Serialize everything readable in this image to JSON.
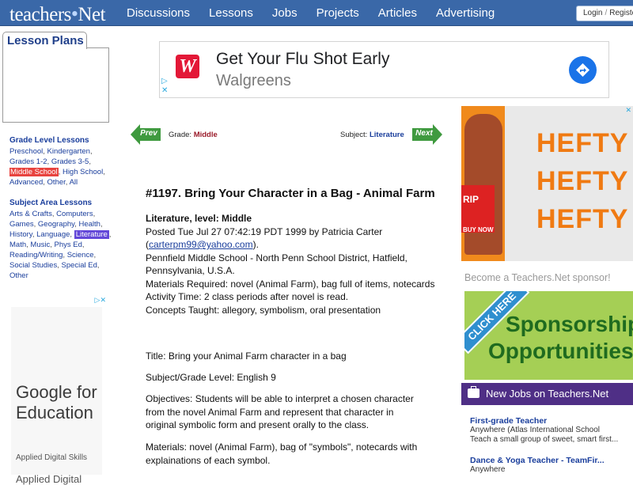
{
  "header": {
    "logo": "teachers",
    "logo_tld": "net",
    "nav": [
      "Discussions",
      "Lessons",
      "Jobs",
      "Projects",
      "Articles",
      "Advertising"
    ],
    "login": "Login",
    "register": "Registe"
  },
  "sidebar": {
    "tab_title": "Lesson Plans",
    "grade_heading": "Grade Level Lessons",
    "grade_links": [
      "Preschool",
      "Kindergarten",
      "Grades 1-2",
      "Grades 3-5",
      "Middle School",
      "High School",
      "Advanced",
      "Other",
      "All"
    ],
    "subject_heading": "Subject Area Lessons",
    "subject_links": [
      "Arts & Crafts",
      "Computers",
      "Games",
      "Geography",
      "Health",
      "History",
      "Language",
      "Literature",
      "Math",
      "Music",
      "Phys Ed",
      "Reading/Writing",
      "Science",
      "Social Studies",
      "Special Ed",
      "Other"
    ],
    "ad_title": "Google for Education",
    "ad_sub": "Applied Digital Skills",
    "ad_sub2": "Applied Digital"
  },
  "banner_ad": {
    "headline": "Get Your Flu Shot Early",
    "brand": "Walgreens",
    "logo_letter": "W"
  },
  "lesson_nav": {
    "prev": "Prev",
    "next": "Next",
    "grade_label": "Grade:",
    "grade_value": "Middle",
    "subject_label": "Subject:",
    "subject_value": "Literature"
  },
  "lesson": {
    "title": "#1197. Bring Your Character in a Bag - Animal Farm",
    "level_line": "Literature, level: Middle",
    "posted": "Posted Tue Jul 27 07:42:19 PDT 1999 by Patricia Carter",
    "email": "carterpm99@yahoo.com",
    "school": "Pennfield Middle School - North Penn School District, Hatfield, Pennsylvania, U.S.A.",
    "materials_required": "Materials Required: novel (Animal Farm), bag full of items, notecards",
    "activity_time": "Activity Time: 2 class periods after novel is read.",
    "concepts": "Concepts Taught: allegory, symbolism, oral presentation",
    "body_title": "Title: Bring your Animal Farm character in a bag",
    "body_subject": "Subject/Grade Level: English 9",
    "body_objectives": "Objectives: Students will be able to interpret a chosen character from the novel Animal Farm and represent that character in original symbolic form and present orally to the class.",
    "body_materials": "Materials: novel (Animal Farm), bag of \"symbols\", notecards with explainations of each symbol."
  },
  "right_col": {
    "hefty_ad_word": "HEFTY",
    "hefty_pkg": "RIP",
    "hefty_buy": "BUY NOW",
    "sponsor_line": "Become a Teachers.Net sponsor!",
    "sponsor_ribbon": "CLICK HERE",
    "sponsor_t1": "Sponsorship",
    "sponsor_t2": "Opportunities",
    "jobs_heading": "New Jobs on Teachers.Net",
    "jobs": [
      {
        "title": "First-grade Teacher",
        "line1": "Anywhere (Atlas International School",
        "line2": "Teach a small group of sweet, smart first..."
      },
      {
        "title": "Dance & Yoga Teacher - TeamFir...",
        "line1": "Anywhere",
        "line2": ""
      }
    ]
  },
  "colors": {
    "nav_bg": "#3a68a8",
    "link": "#1a3e9c",
    "highlight_red": "#e8433f",
    "highlight_purple": "#6347d8",
    "jobs_bar": "#4f2f86",
    "arrow_green": "#3f9a3f"
  }
}
